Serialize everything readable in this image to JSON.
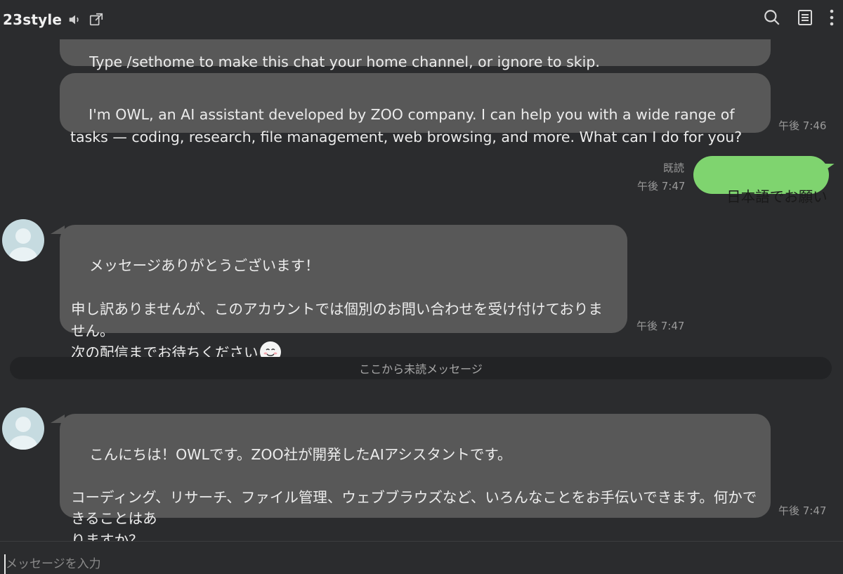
{
  "header": {
    "title": "23style",
    "icons": [
      "speaker-icon",
      "external-link-icon",
      "search-icon",
      "notes-icon",
      "more-vertical-icon"
    ]
  },
  "messages": [
    {
      "id": "m0",
      "sender": "bot",
      "text": "Type /sethome to make this chat your home channel, or ignore to skip.",
      "time": ""
    },
    {
      "id": "m1",
      "sender": "bot",
      "text": "I'm OWL, an AI assistant developed by ZOO company. I can help you with a wide range of\ntasks — coding, research, file management, web browsing, and more. What can I do for you?",
      "time": "午後 7:46"
    },
    {
      "id": "m2",
      "sender": "me",
      "text": "日本語でお願い",
      "read": "既読",
      "time": "午後 7:47"
    },
    {
      "id": "m3",
      "sender": "account",
      "text": "メッセージありがとうございます！\n\n申し訳ありませんが、このアカウントでは個別のお問い合わせを受け付けておりません。\n次の配信までお待ちください",
      "time": "午後 7:47"
    },
    {
      "id": "m4",
      "sender": "account",
      "text": "こんにちは！OWLです。ZOO社が開発したAIアシスタントです。\n\nコーディング、リサーチ、ファイル管理、ウェブブラウズなど、いろんなことをお手伝いできます。何かできることはあ\nりますか？",
      "time": "午後 7:47"
    }
  ],
  "divider": {
    "label": "ここから未読メッセージ"
  },
  "composer": {
    "placeholder": "メッセージを入力"
  },
  "colors": {
    "background": "#2b2c2e",
    "bubble_other": "#585858",
    "bubble_me": "#7fd46f",
    "divider_bg": "#222325",
    "timestamp": "#9a9a9a"
  }
}
